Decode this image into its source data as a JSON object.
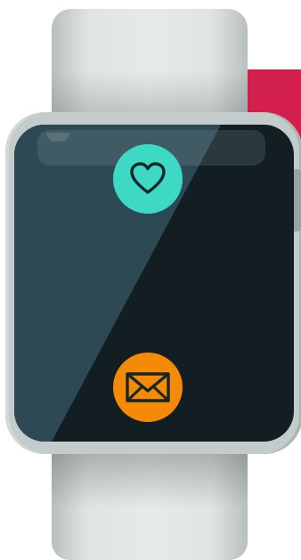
{
  "watch": {
    "band_color": "#dfe4e3",
    "case_color": "#c4cbcb",
    "screen_color": "#121e22",
    "screen_glare_color": "#2d4954"
  },
  "background_stripes": [
    {
      "color": "#d21f4c"
    },
    {
      "color": "#a8ba2e"
    },
    {
      "color": "#c8ccb0"
    },
    {
      "color": "#3ab5c6"
    },
    {
      "color": "#f5a81c"
    },
    {
      "color": "#1e5f74"
    }
  ],
  "apps": [
    {
      "id": "health",
      "icon": "heart-icon",
      "color": "#3dd9c4"
    },
    {
      "id": "mail",
      "icon": "mail-icon",
      "color": "#f58a07"
    }
  ]
}
